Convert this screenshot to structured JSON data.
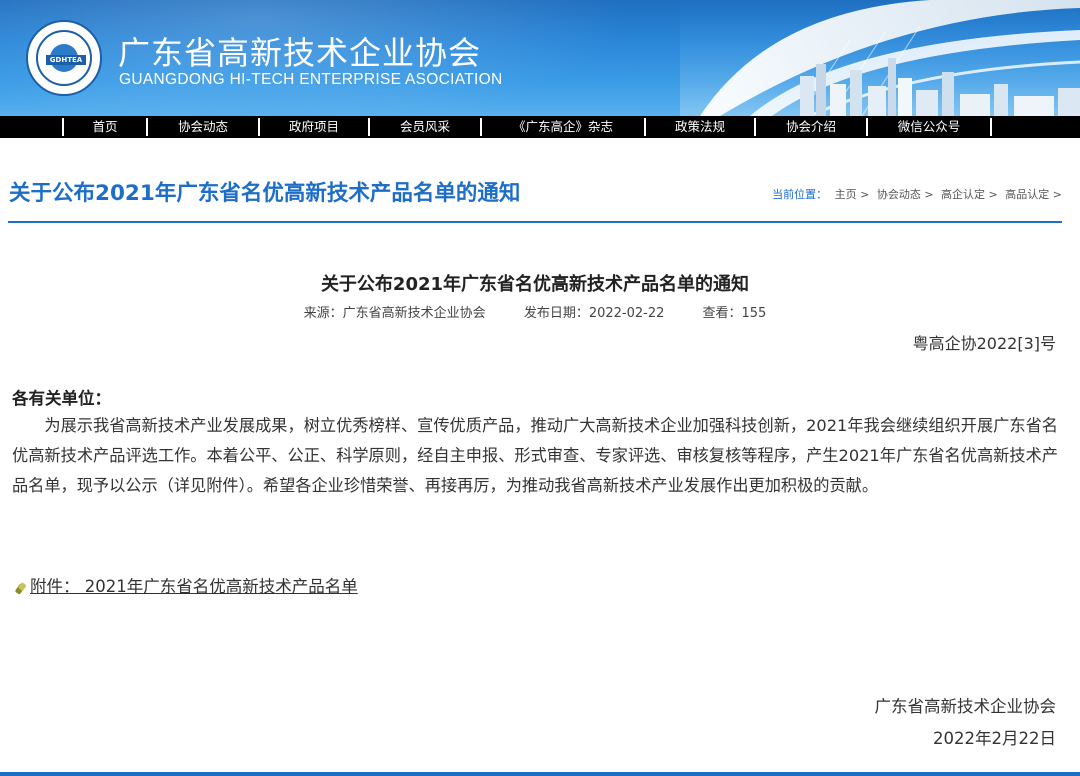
{
  "header": {
    "title": "广东省高新技术企业协会",
    "subtitle": "GUANGDONG HI-TECH ENTERPRISE ASOCIATION",
    "logo_text": "GDHTEA"
  },
  "nav": {
    "items": [
      {
        "label": "首页"
      },
      {
        "label": "协会动态"
      },
      {
        "label": "政府项目"
      },
      {
        "label": "会员风采"
      },
      {
        "label": "《广东高企》杂志"
      },
      {
        "label": "政策法规"
      },
      {
        "label": "协会介绍"
      },
      {
        "label": "微信公众号"
      }
    ]
  },
  "page": {
    "title": "关于公布2021年广东省名优高新技术产品名单的通知",
    "breadcrumb": {
      "label": "当前位置：",
      "items": [
        "主页 >",
        "协会动态 >",
        "高企认定 >",
        "高品认定 >"
      ]
    }
  },
  "article": {
    "title": "关于公布2021年广东省名优高新技术产品名单的通知",
    "source": "来源：广东省高新技术企业协会",
    "date": "发布日期：2022-02-22",
    "views": "查看：155",
    "doc_number": "粤高企协2022[3]号",
    "salutation": "各有关单位：",
    "body": "为展示我省高新技术产业发展成果，树立优秀榜样、宣传优质产品，推动广大高新技术企业加强科技创新，2021年我会继续组织开展广东省名优高新技术产品评选工作。本着公平、公正、科学原则，经自主申报、形式审查、专家评选、审核复核等程序，产生2021年广东省名优高新技术产品名单，现予以公示（详见附件）。希望各企业珍惜荣誉、再接再厉，为推动我省高新技术产业发展作出更加积极的贡献。",
    "attachment": "附件： 2021年广东省名优高新技术产品名单",
    "sign_org": "广东省高新技术企业协会",
    "sign_date": "2022年2月22日"
  },
  "colors": {
    "accent": "#1e6ec8",
    "nav_bg": "#000000",
    "banner": "#2a86d8"
  }
}
